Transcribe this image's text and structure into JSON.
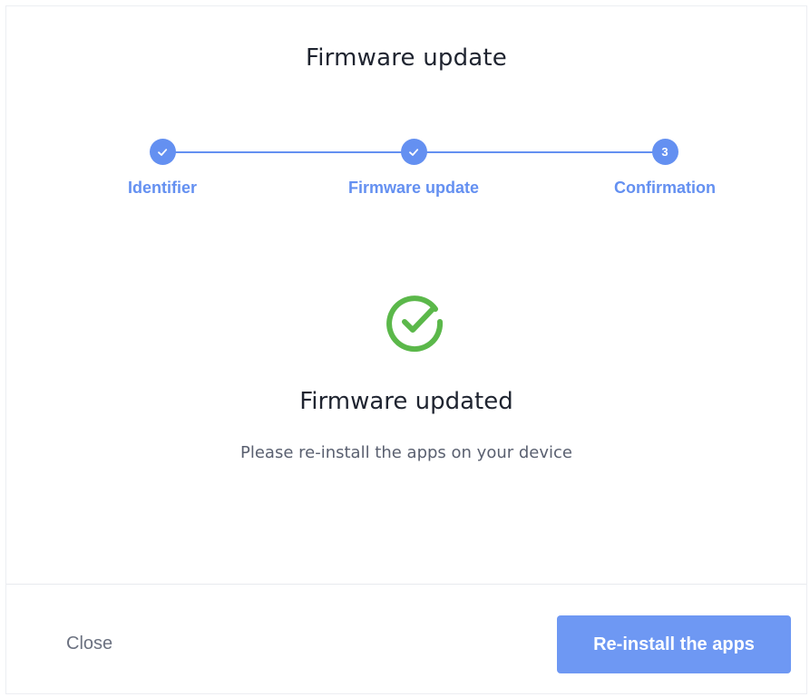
{
  "dialog": {
    "title": "Firmware update"
  },
  "stepper": {
    "steps": [
      {
        "label": "Identifier",
        "state": "completed",
        "icon": "check-icon"
      },
      {
        "label": "Firmware update",
        "state": "completed",
        "icon": "check-icon"
      },
      {
        "label": "Confirmation",
        "state": "current",
        "number": "3"
      }
    ]
  },
  "result": {
    "icon": "success-check-circle-icon",
    "title": "Firmware updated",
    "description": "Please re-install the apps on your device"
  },
  "footer": {
    "close_label": "Close",
    "primary_label": "Re-install the apps"
  },
  "colors": {
    "accent": "#6490f1",
    "success": "#5bb84a",
    "primary_button": "#6e98f3"
  }
}
